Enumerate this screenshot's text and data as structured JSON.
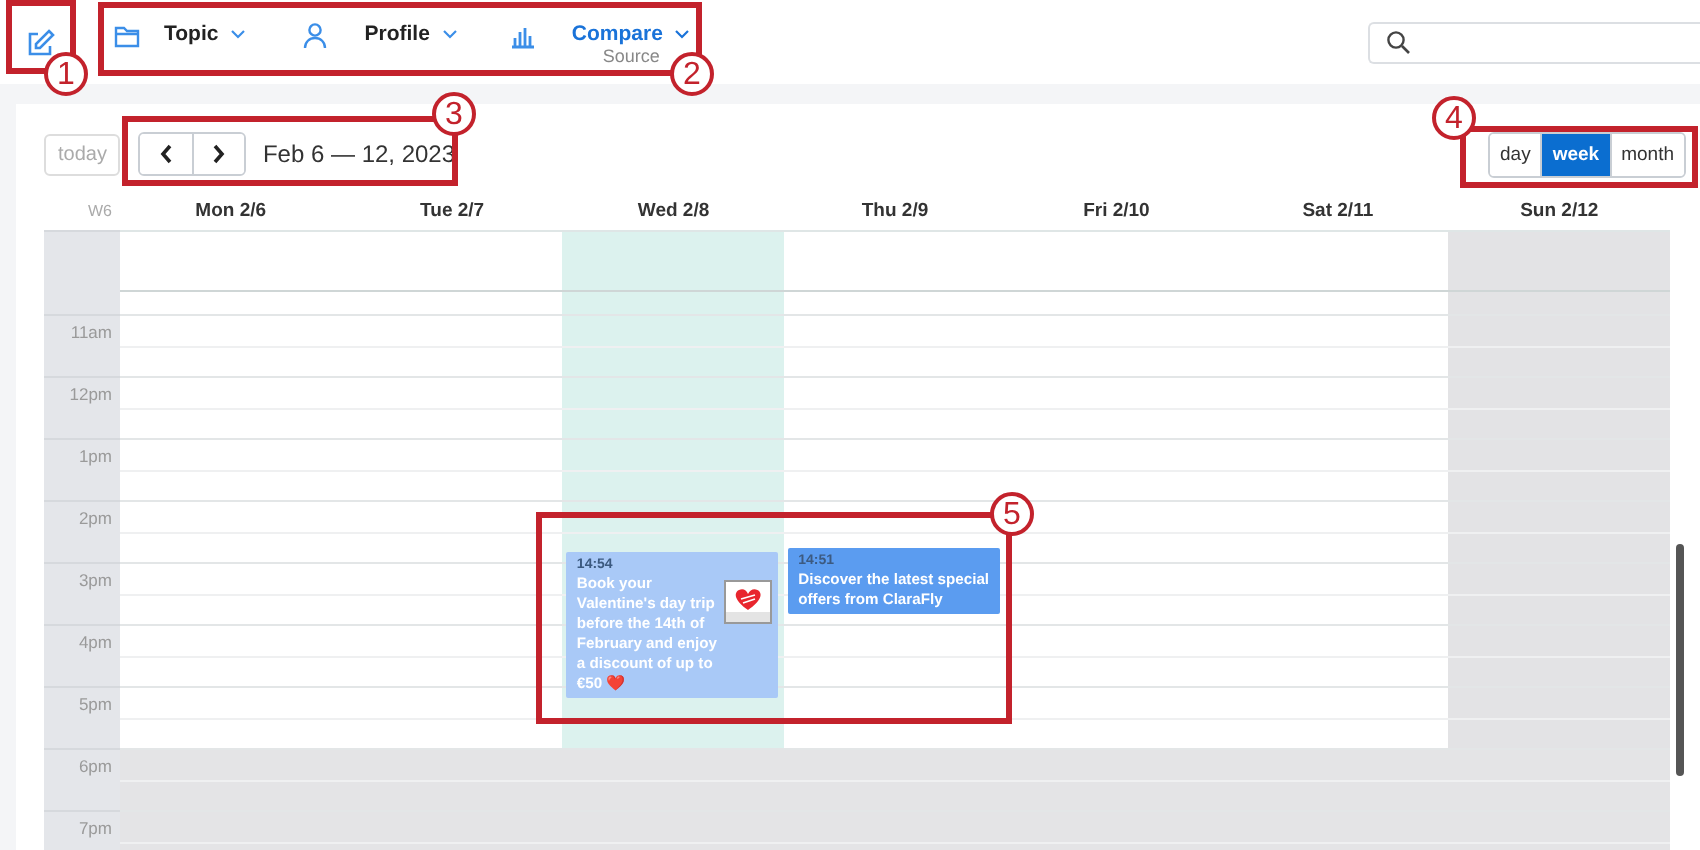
{
  "toolbar": {
    "nav_items": [
      {
        "label": "Topic",
        "selected": false
      },
      {
        "label": "Profile",
        "selected": false
      },
      {
        "label": "Compare",
        "subtitle": "Source",
        "selected": true
      }
    ]
  },
  "calendar": {
    "today_button": "today",
    "date_range": "Feb 6 — 12, 2023",
    "views": [
      {
        "label": "day",
        "selected": false
      },
      {
        "label": "week",
        "selected": true
      },
      {
        "label": "month",
        "selected": false
      }
    ],
    "week_label": "W6",
    "days": [
      {
        "label": "Mon 2/6",
        "today": false,
        "shaded": false
      },
      {
        "label": "Tue 2/7",
        "today": false,
        "shaded": false
      },
      {
        "label": "Wed 2/8",
        "today": true,
        "shaded": false,
        "events": [
          {
            "time": "14:54",
            "text": "Book your Valentine's day trip before the 14th of February and enjoy a discount of up to €50 ❤️",
            "color": "#a9c9f7",
            "kind": "picture"
          }
        ]
      },
      {
        "label": "Thu 2/9",
        "today": false,
        "shaded": false,
        "events": [
          {
            "time": "14:51",
            "text": "Discover the latest special offers from ClaraFly",
            "color": "#5b9cf0"
          }
        ]
      },
      {
        "label": "Fri 2/10",
        "today": false,
        "shaded": false
      },
      {
        "label": "Sat 2/11",
        "today": false,
        "shaded": false
      },
      {
        "label": "Sun 2/12",
        "today": false,
        "shaded": true
      }
    ],
    "hours": [
      {
        "label": "11am",
        "off_hours": false
      },
      {
        "label": "12pm",
        "off_hours": false
      },
      {
        "label": "1pm",
        "off_hours": false
      },
      {
        "label": "2pm",
        "off_hours": false
      },
      {
        "label": "3pm",
        "off_hours": false
      },
      {
        "label": "4pm",
        "off_hours": false
      },
      {
        "label": "5pm",
        "off_hours": false
      },
      {
        "label": "6pm",
        "off_hours": true
      },
      {
        "label": "7pm",
        "off_hours": true
      }
    ]
  },
  "callouts": [
    {
      "number": "1"
    },
    {
      "number": "2"
    },
    {
      "number": "3"
    },
    {
      "number": "4"
    },
    {
      "number": "5"
    }
  ]
}
